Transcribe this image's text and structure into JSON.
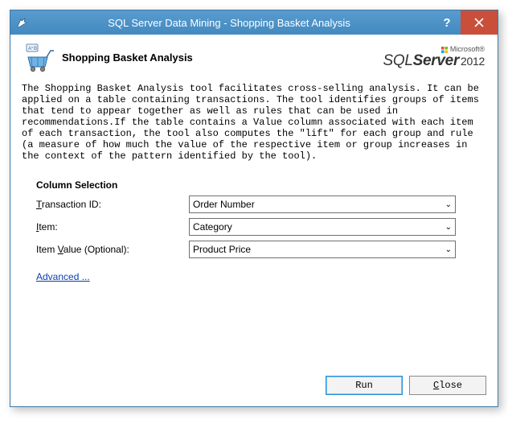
{
  "window": {
    "title": "SQL Server Data Mining - Shopping Basket Analysis"
  },
  "header": {
    "title": "Shopping Basket Analysis",
    "brand_small": "Microsoft®",
    "brand_sql": "SQL",
    "brand_server": "Server",
    "brand_year": "2012"
  },
  "description": "The Shopping Basket Analysis tool facilitates cross-selling analysis. It can be applied on a table containing transactions. The tool identifies groups of items that tend to appear together as well as rules that can be used in recommendations.If the table contains a Value column associated with each item of each transaction, the tool also computes the \"lift\" for each group and rule (a measure of how much the value of the respective item or group increases in the context of the pattern identified by the tool).",
  "section": {
    "title": "Column Selection",
    "rows": {
      "transaction": {
        "label_ul": "T",
        "label_rest": "ransaction ID:",
        "value": "Order Number"
      },
      "item": {
        "label_ul": "I",
        "label_rest": "tem:",
        "value": "Category"
      },
      "itemvalue": {
        "label_pre": "Item ",
        "label_ul": "V",
        "label_rest": "alue (Optional):",
        "value": "Product Price"
      }
    },
    "advanced_label": "Advanced ..."
  },
  "footer": {
    "run": "Run",
    "close_ul": "C",
    "close_rest": "lose"
  }
}
